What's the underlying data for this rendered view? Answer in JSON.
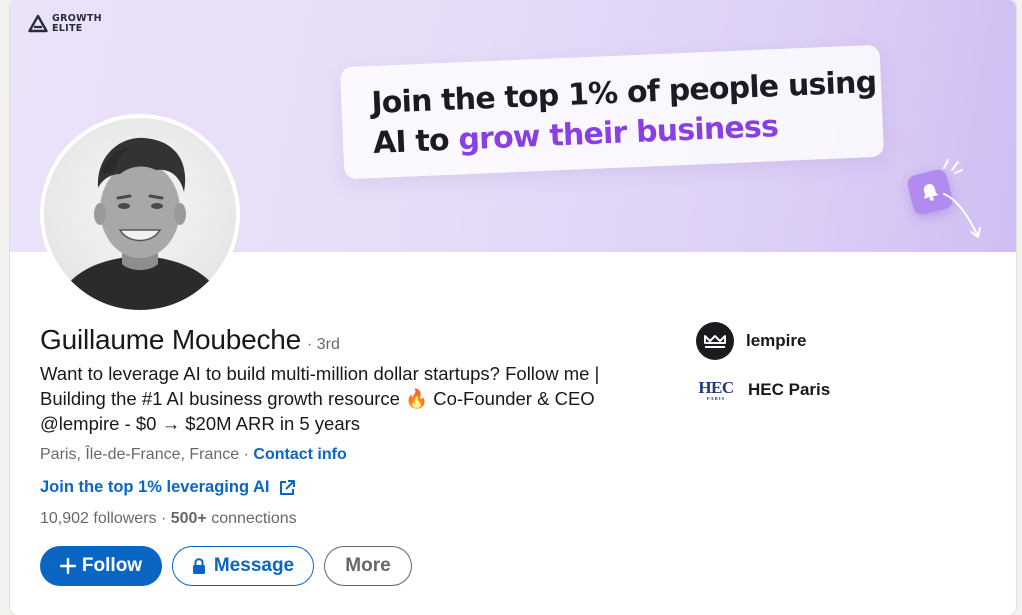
{
  "banner": {
    "logo_line1": "GROWTH",
    "logo_line2": "ELITE",
    "tagline_part1": "Join the top 1% of people using",
    "tagline_part2": "AI to ",
    "tagline_highlight": "grow their business"
  },
  "profile": {
    "name": "Guillaume Moubeche",
    "degree": "· 3rd",
    "headline": "Want to leverage AI to build multi-million dollar startups? Follow me | Building the #1 AI business growth resource 🔥 Co-Founder & CEO @lempire - $0 → $20M ARR in 5 years",
    "location": "Paris, Île-de-France, France · ",
    "contact_label": "Contact info",
    "external_link": "Join the top 1% leveraging AI",
    "followers": "10,902 followers",
    "separator": " · ",
    "connections_count": "500+",
    "connections_label": " connections"
  },
  "actions": {
    "follow_label": "Follow",
    "message_label": "Message",
    "more_label": "More"
  },
  "organizations": [
    {
      "name": "lempire",
      "icon": "lempire-logo"
    },
    {
      "name": "HEC Paris",
      "icon": "hec-logo",
      "logo_text": "HEC",
      "logo_sub": "PARIS"
    }
  ],
  "colors": {
    "brand_blue": "#0a66c2",
    "highlight_purple": "#8a3fe0"
  }
}
